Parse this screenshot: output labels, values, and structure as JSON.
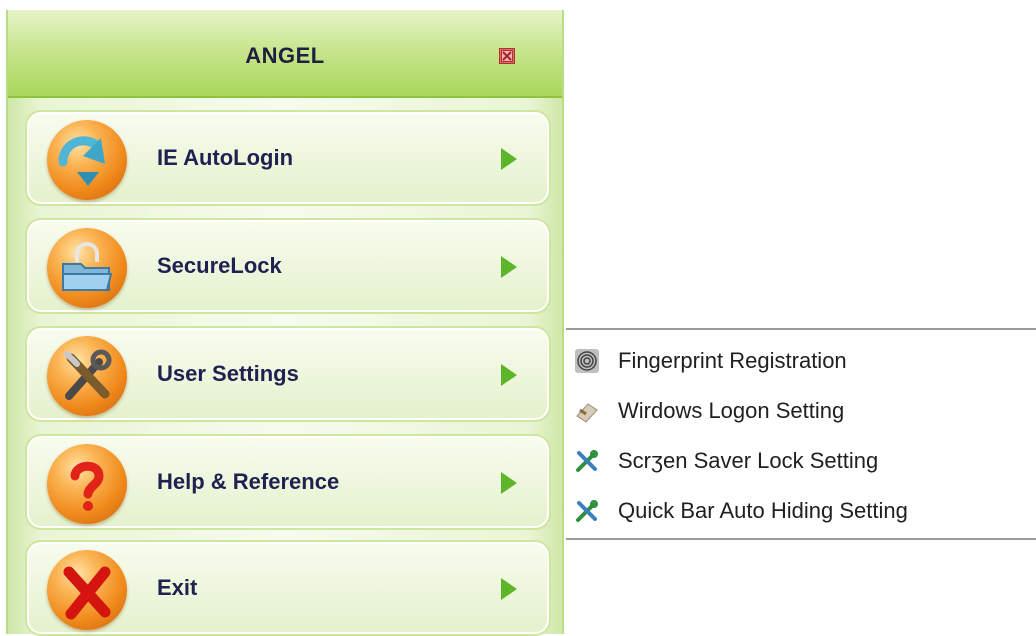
{
  "window": {
    "title": "ANGEL"
  },
  "menu": {
    "items": [
      {
        "label": "IE AutoLogin",
        "icon": "ie-autologin-download-icon"
      },
      {
        "label": "SecureLock",
        "icon": "folder-lock-icon"
      },
      {
        "label": "User Settings",
        "icon": "tools-icon"
      },
      {
        "label": "Help & Reference",
        "icon": "question-mark-icon"
      },
      {
        "label": "Exit",
        "icon": "exit-x-icon"
      }
    ]
  },
  "submenu": {
    "items": [
      {
        "label": "Fingerprint Registration",
        "icon": "fingerprint-icon"
      },
      {
        "label": "Wirdows Logon Setting",
        "icon": "windows-logon-icon"
      },
      {
        "label": "Scrʒen Saver Lock Setting",
        "icon": "tools-icon"
      },
      {
        "label": "Quick Bar Auto Hiding Setting",
        "icon": "tools-icon"
      }
    ]
  },
  "colors": {
    "accent_green": "#8cc53d",
    "arrow_green": "#5db52a",
    "orb_orange": "#f08a1c",
    "label_navy": "#1f2150"
  }
}
